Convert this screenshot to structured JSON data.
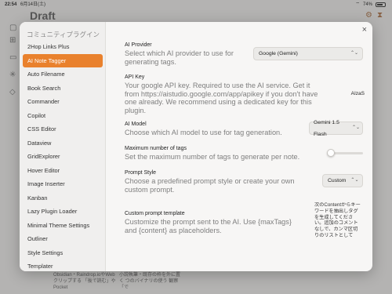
{
  "statusbar": {
    "time": "22:54",
    "date": "6月14日(土)",
    "battery": "74%"
  },
  "background": {
    "title": "Draft",
    "bottom_text_1": "Obsidian・Raindrop.ioやWebクリップする 「後で読む」やPocket",
    "bottom_text_2": "小説執筆・既存の枠を外に置く つのバイナリの使う 観察 「で"
  },
  "modal": {
    "sidebar": {
      "heading": "コミュニティプラグイン",
      "items": [
        {
          "label": "2Hop Links Plus",
          "active": false
        },
        {
          "label": "AI Note Tagger",
          "active": true
        },
        {
          "label": "Auto Filename",
          "active": false
        },
        {
          "label": "Book Search",
          "active": false
        },
        {
          "label": "Commander",
          "active": false
        },
        {
          "label": "Copilot",
          "active": false
        },
        {
          "label": "CSS Editor",
          "active": false
        },
        {
          "label": "Dataview",
          "active": false
        },
        {
          "label": "GridExplorer",
          "active": false
        },
        {
          "label": "Hover Editor",
          "active": false
        },
        {
          "label": "Image Inserter",
          "active": false
        },
        {
          "label": "Kanban",
          "active": false
        },
        {
          "label": "Lazy Plugin Loader",
          "active": false
        },
        {
          "label": "Minimal Theme Settings",
          "active": false
        },
        {
          "label": "Outliner",
          "active": false
        },
        {
          "label": "Style Settings",
          "active": false
        },
        {
          "label": "Templater",
          "active": false
        },
        {
          "label": "Thino",
          "active": false
        }
      ]
    },
    "close_label": "×",
    "settings": {
      "provider": {
        "name": "AI Provider",
        "desc": "Select which AI provider to use for generating tags.",
        "value": "Google (Gemini)"
      },
      "api_key": {
        "name": "API Key",
        "desc": "Your google API key. Required to use the AI service. Get it from https://aistudio.google.com/app/apikey if you don't have one already. We recommend using a dedicated key for this plugin.",
        "value": "AIzaS"
      },
      "model": {
        "name": "AI Model",
        "desc": "Choose which AI model to use for tag generation.",
        "value": "Gemini 1.5 Flash"
      },
      "max_tags": {
        "name": "Maximum number of tags",
        "desc": "Set the maximum number of tags to generate per note.",
        "level": 0.1
      },
      "prompt_style": {
        "name": "Prompt Style",
        "desc": "Choose a predefined prompt style or create your own custom prompt.",
        "value": "Custom"
      },
      "prompt_template": {
        "name": "Custom prompt template",
        "desc": "Customize the prompt sent to the AI. Use {maxTags} and {content} as placeholders.",
        "value": "次のContentからキーワードを抽出しタグを生成してください。追加のコメントなしで、カンマ区切りのリストとして"
      }
    }
  }
}
